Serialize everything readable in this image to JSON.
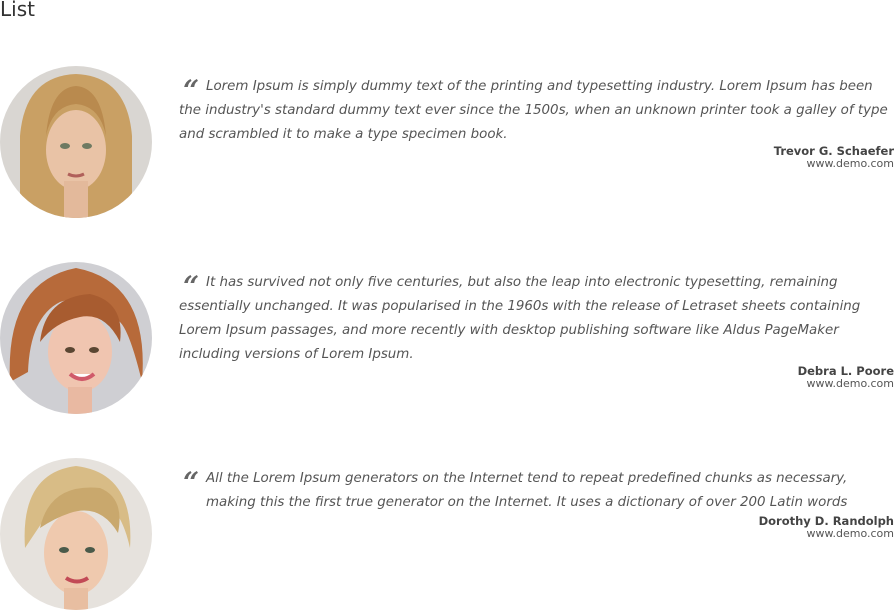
{
  "page": {
    "title": "List"
  },
  "testimonials": [
    {
      "quote": "Lorem Ipsum is simply dummy text of the printing and typesetting industry. Lorem Ipsum has been the industry's standard dummy text ever since the 1500s, when an unknown printer took a galley of type and scrambled it to make a type specimen book.",
      "author": "Trevor G. Schaefer",
      "site": "www.demo.com",
      "avatar_icon": "person-photo-icon"
    },
    {
      "quote": "It has survived not only five centuries, but also the leap into electronic typesetting, remaining essentially unchanged. It was popularised in the 1960s with the release of Letraset sheets containing Lorem Ipsum passages, and more recently with desktop publishing software like Aldus PageMaker including versions of Lorem Ipsum.",
      "author": "Debra L. Poore",
      "site": "www.demo.com",
      "avatar_icon": "person-photo-icon"
    },
    {
      "quote": "All the Lorem Ipsum generators on the Internet tend to repeat predefined chunks as necessary, making this the first true generator on the Internet. It uses a dictionary of over 200 Latin words",
      "author": "Dorothy D. Randolph",
      "site": "www.demo.com",
      "avatar_icon": "person-photo-icon"
    }
  ],
  "colors": {
    "text": "#555555",
    "heading": "#333333",
    "author": "#444444"
  }
}
